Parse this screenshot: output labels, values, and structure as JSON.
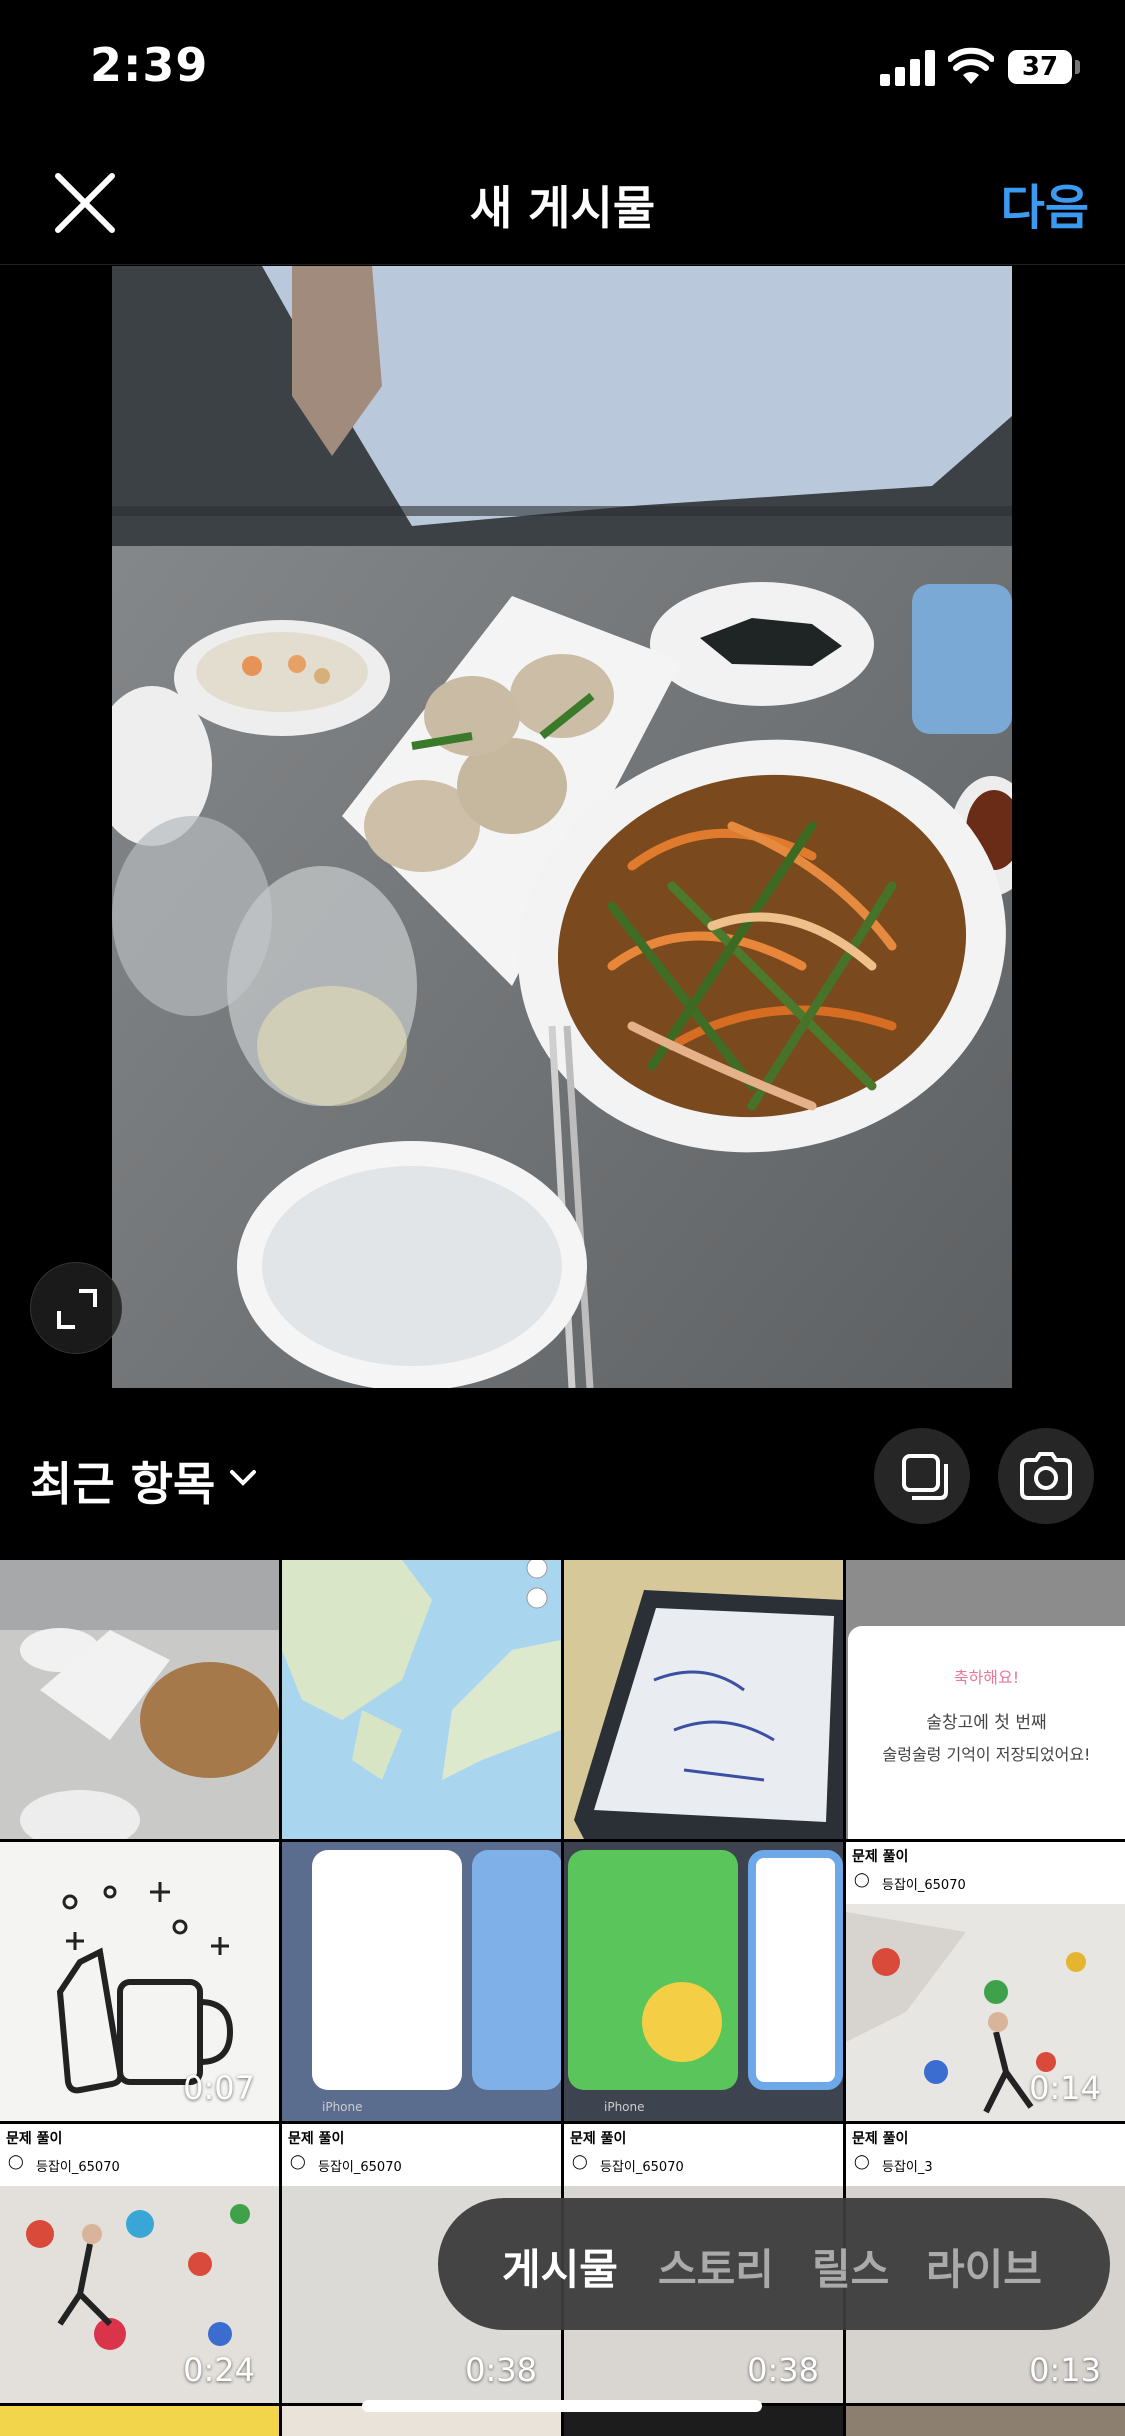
{
  "status": {
    "time": "2:39",
    "battery": "37"
  },
  "nav": {
    "title": "새 게시물",
    "next_label": "다음"
  },
  "album": {
    "title": "최근 항목"
  },
  "grid": {
    "durations": [
      "0:07",
      "0:14",
      "0:24",
      "0:38",
      "0:38",
      "0:13"
    ],
    "popup_title": "축하해요!",
    "popup_line1": "술창고에 첫 번째",
    "popup_line2": "술렁술렁 기억이 저장되었어요!",
    "caption_title": "문제 풀이",
    "caption_user1": "등잡이_65070",
    "caption_user2": "등잡이_3",
    "iphone_label": "iPhone"
  },
  "modes": [
    "게시물",
    "스토리",
    "릴스",
    "라이브"
  ],
  "colors": {
    "accent": "#3b9bf0"
  }
}
